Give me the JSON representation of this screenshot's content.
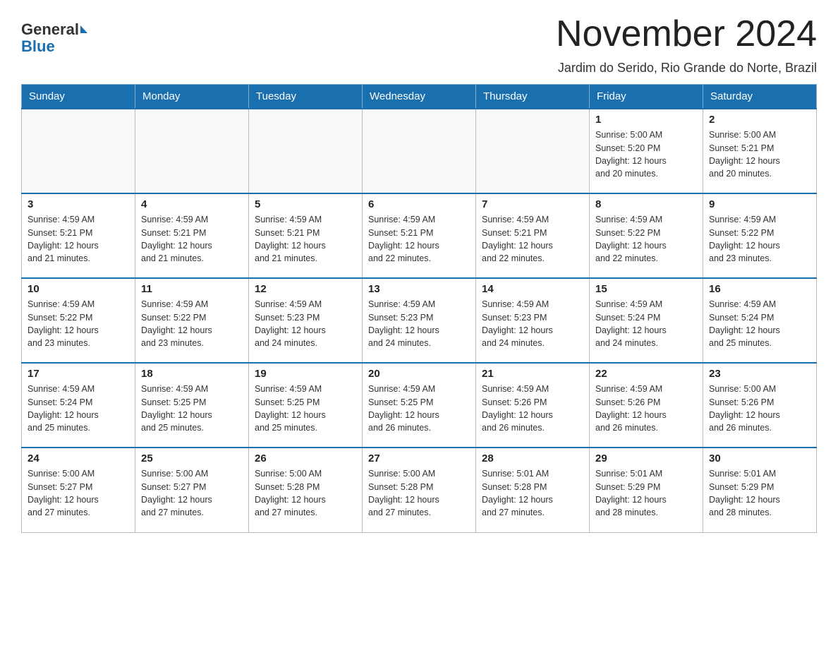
{
  "header": {
    "logo_general": "General",
    "logo_blue": "Blue",
    "month_title": "November 2024",
    "location": "Jardim do Serido, Rio Grande do Norte, Brazil"
  },
  "days_of_week": [
    "Sunday",
    "Monday",
    "Tuesday",
    "Wednesday",
    "Thursday",
    "Friday",
    "Saturday"
  ],
  "weeks": [
    [
      {
        "day": "",
        "info": ""
      },
      {
        "day": "",
        "info": ""
      },
      {
        "day": "",
        "info": ""
      },
      {
        "day": "",
        "info": ""
      },
      {
        "day": "",
        "info": ""
      },
      {
        "day": "1",
        "info": "Sunrise: 5:00 AM\nSunset: 5:20 PM\nDaylight: 12 hours\nand 20 minutes."
      },
      {
        "day": "2",
        "info": "Sunrise: 5:00 AM\nSunset: 5:21 PM\nDaylight: 12 hours\nand 20 minutes."
      }
    ],
    [
      {
        "day": "3",
        "info": "Sunrise: 4:59 AM\nSunset: 5:21 PM\nDaylight: 12 hours\nand 21 minutes."
      },
      {
        "day": "4",
        "info": "Sunrise: 4:59 AM\nSunset: 5:21 PM\nDaylight: 12 hours\nand 21 minutes."
      },
      {
        "day": "5",
        "info": "Sunrise: 4:59 AM\nSunset: 5:21 PM\nDaylight: 12 hours\nand 21 minutes."
      },
      {
        "day": "6",
        "info": "Sunrise: 4:59 AM\nSunset: 5:21 PM\nDaylight: 12 hours\nand 22 minutes."
      },
      {
        "day": "7",
        "info": "Sunrise: 4:59 AM\nSunset: 5:21 PM\nDaylight: 12 hours\nand 22 minutes."
      },
      {
        "day": "8",
        "info": "Sunrise: 4:59 AM\nSunset: 5:22 PM\nDaylight: 12 hours\nand 22 minutes."
      },
      {
        "day": "9",
        "info": "Sunrise: 4:59 AM\nSunset: 5:22 PM\nDaylight: 12 hours\nand 23 minutes."
      }
    ],
    [
      {
        "day": "10",
        "info": "Sunrise: 4:59 AM\nSunset: 5:22 PM\nDaylight: 12 hours\nand 23 minutes."
      },
      {
        "day": "11",
        "info": "Sunrise: 4:59 AM\nSunset: 5:22 PM\nDaylight: 12 hours\nand 23 minutes."
      },
      {
        "day": "12",
        "info": "Sunrise: 4:59 AM\nSunset: 5:23 PM\nDaylight: 12 hours\nand 24 minutes."
      },
      {
        "day": "13",
        "info": "Sunrise: 4:59 AM\nSunset: 5:23 PM\nDaylight: 12 hours\nand 24 minutes."
      },
      {
        "day": "14",
        "info": "Sunrise: 4:59 AM\nSunset: 5:23 PM\nDaylight: 12 hours\nand 24 minutes."
      },
      {
        "day": "15",
        "info": "Sunrise: 4:59 AM\nSunset: 5:24 PM\nDaylight: 12 hours\nand 24 minutes."
      },
      {
        "day": "16",
        "info": "Sunrise: 4:59 AM\nSunset: 5:24 PM\nDaylight: 12 hours\nand 25 minutes."
      }
    ],
    [
      {
        "day": "17",
        "info": "Sunrise: 4:59 AM\nSunset: 5:24 PM\nDaylight: 12 hours\nand 25 minutes."
      },
      {
        "day": "18",
        "info": "Sunrise: 4:59 AM\nSunset: 5:25 PM\nDaylight: 12 hours\nand 25 minutes."
      },
      {
        "day": "19",
        "info": "Sunrise: 4:59 AM\nSunset: 5:25 PM\nDaylight: 12 hours\nand 25 minutes."
      },
      {
        "day": "20",
        "info": "Sunrise: 4:59 AM\nSunset: 5:25 PM\nDaylight: 12 hours\nand 26 minutes."
      },
      {
        "day": "21",
        "info": "Sunrise: 4:59 AM\nSunset: 5:26 PM\nDaylight: 12 hours\nand 26 minutes."
      },
      {
        "day": "22",
        "info": "Sunrise: 4:59 AM\nSunset: 5:26 PM\nDaylight: 12 hours\nand 26 minutes."
      },
      {
        "day": "23",
        "info": "Sunrise: 5:00 AM\nSunset: 5:26 PM\nDaylight: 12 hours\nand 26 minutes."
      }
    ],
    [
      {
        "day": "24",
        "info": "Sunrise: 5:00 AM\nSunset: 5:27 PM\nDaylight: 12 hours\nand 27 minutes."
      },
      {
        "day": "25",
        "info": "Sunrise: 5:00 AM\nSunset: 5:27 PM\nDaylight: 12 hours\nand 27 minutes."
      },
      {
        "day": "26",
        "info": "Sunrise: 5:00 AM\nSunset: 5:28 PM\nDaylight: 12 hours\nand 27 minutes."
      },
      {
        "day": "27",
        "info": "Sunrise: 5:00 AM\nSunset: 5:28 PM\nDaylight: 12 hours\nand 27 minutes."
      },
      {
        "day": "28",
        "info": "Sunrise: 5:01 AM\nSunset: 5:28 PM\nDaylight: 12 hours\nand 27 minutes."
      },
      {
        "day": "29",
        "info": "Sunrise: 5:01 AM\nSunset: 5:29 PM\nDaylight: 12 hours\nand 28 minutes."
      },
      {
        "day": "30",
        "info": "Sunrise: 5:01 AM\nSunset: 5:29 PM\nDaylight: 12 hours\nand 28 minutes."
      }
    ]
  ]
}
